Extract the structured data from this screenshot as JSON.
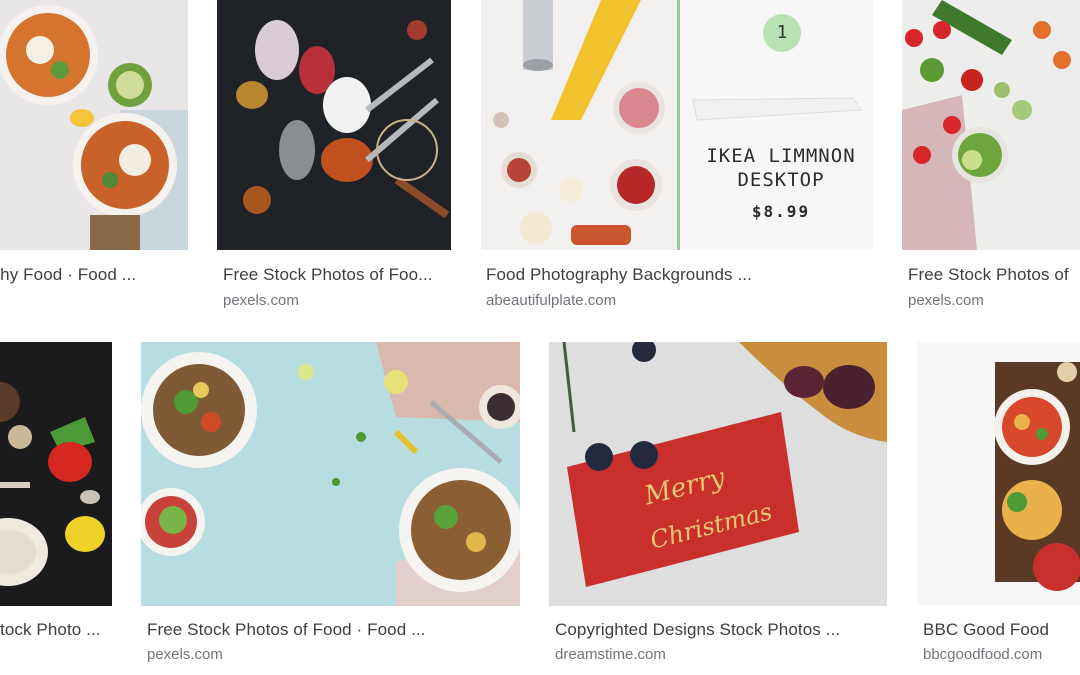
{
  "results": [
    {
      "title": "Healthy Food · Food ...",
      "source": "",
      "thumb_icon": "fries-bowls-image"
    },
    {
      "title": "Free Stock Photos of Foo...",
      "source": "pexels.com",
      "thumb_icon": "spices-spoons-image"
    },
    {
      "title": "Food Photography Backgrounds ...",
      "source": "abeautifulplate.com",
      "thumb_icon": "ingredients-flatlay-image",
      "overlay": {
        "badge": "1",
        "product": "IKEA LIMMNON",
        "product2": "DESKTOP",
        "price": "$8.99"
      }
    },
    {
      "title": "Free Stock Photos of",
      "source": "pexels.com",
      "thumb_icon": "vegetables-image"
    },
    {
      "title": "tock Photo ...",
      "source": "",
      "thumb_icon": "dark-food-image"
    },
    {
      "title": "Free Stock Photos of Food · Food ...",
      "source": "pexels.com",
      "thumb_icon": "salad-plates-image"
    },
    {
      "title": "Copyrighted Designs Stock Photos ...",
      "source": "dreamstime.com",
      "thumb_icon": "christmas-card-image",
      "overlay": {
        "card_text1": "Merry",
        "card_text2": "Christmas"
      }
    },
    {
      "title": "BBC Good Food",
      "source": "bbcgoodfood.com",
      "thumb_icon": "soup-bowl-image"
    }
  ]
}
